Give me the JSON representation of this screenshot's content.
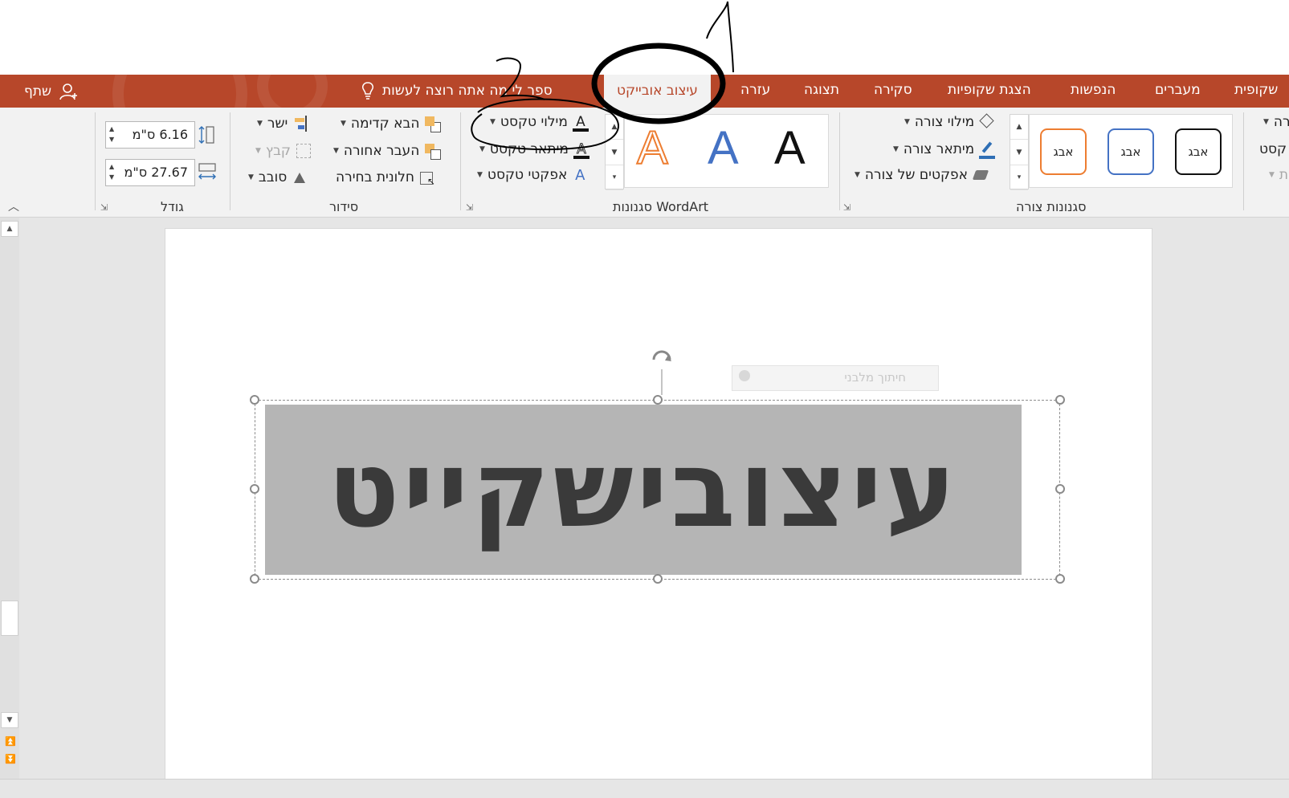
{
  "share": {
    "label": "שתף"
  },
  "tell_me": {
    "text": "ספר לי מה אתה רוצה לעשות"
  },
  "tabs": [
    {
      "label": "עיצוב אובייקט",
      "active": true
    },
    {
      "label": "עזרה"
    },
    {
      "label": "תצוגה"
    },
    {
      "label": "סקירה"
    },
    {
      "label": "הצגת שקופיות"
    },
    {
      "label": "הנפשות"
    },
    {
      "label": "מעברים"
    },
    {
      "label": "שקופית"
    }
  ],
  "ribbon": {
    "size": {
      "label": "גודל",
      "height_value": "6.16 ס\"מ",
      "width_value": "27.67 ס\"מ"
    },
    "arrange": {
      "label": "סידור",
      "bring_forward": "הבא קדימה",
      "send_backward": "העבר אחורה",
      "selection_pane": "חלונית בחירה",
      "align": "ישר",
      "group": "קבץ",
      "rotate": "סובב"
    },
    "wordart": {
      "label": "סגנונות WordArt",
      "text_fill": "מילוי טקסט",
      "text_outline": "מיתאר טקסט",
      "text_effects": "אפקטי טקסט",
      "sample_letter": "A"
    },
    "shape_styles": {
      "label": "סגנונות צורה",
      "shape_fill": "מילוי צורה",
      "shape_outline": "מיתאר צורה",
      "shape_effects": "אפקטים של צורה",
      "swatches": [
        "אבג",
        "אבג",
        "אבג"
      ]
    },
    "insert_shapes_partial": {
      "item1": "רה",
      "item2": "קסט",
      "item3": "ית"
    }
  },
  "slide": {
    "wordart_text": "עיצובישקייט",
    "placeholder_hint": "חיתוך מלבני"
  },
  "colors": {
    "accent": "#b7472a",
    "wordart_orange": "#ed7d31",
    "wordart_blue": "#4472c4",
    "swatch_blue": "#4472c4",
    "swatch_orange": "#ed7d31"
  }
}
